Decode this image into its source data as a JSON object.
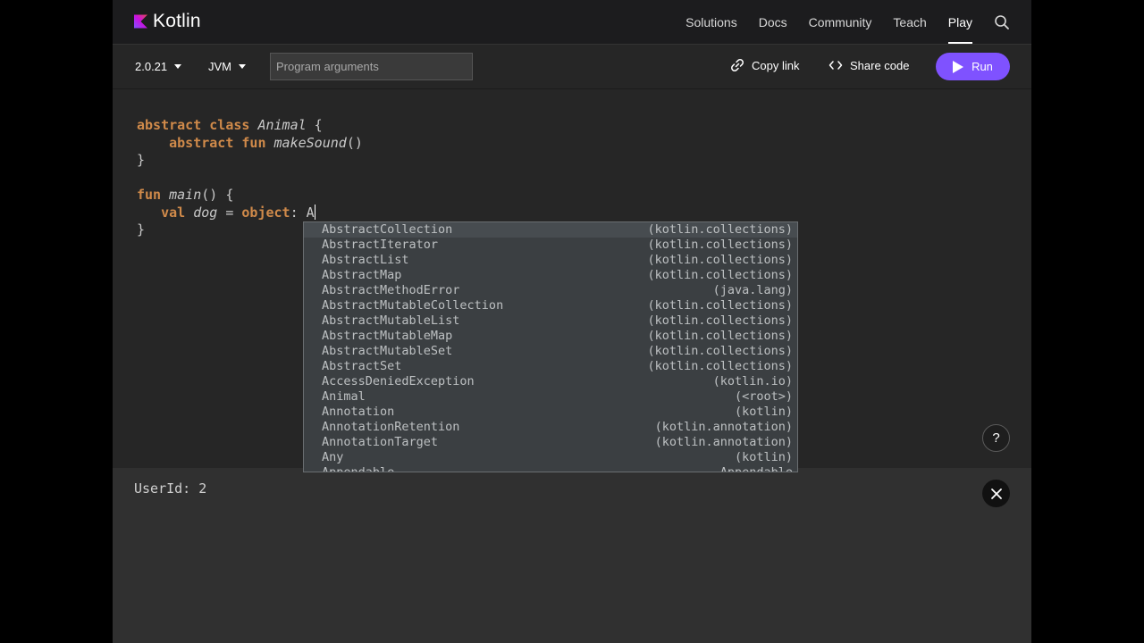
{
  "brand": {
    "name": "Kotlin",
    "logo_colors": [
      "#7f52ff",
      "#c811e1",
      "#e54857"
    ]
  },
  "nav": {
    "links": [
      "Solutions",
      "Docs",
      "Community",
      "Teach",
      "Play"
    ],
    "active": "Play",
    "search_icon": "search-icon"
  },
  "toolbar": {
    "version": "2.0.21",
    "target": "JVM",
    "args_placeholder": "Program arguments",
    "copy_link": "Copy link",
    "share_code": "Share code",
    "run": "Run",
    "run_color": "#7f52ff"
  },
  "editor": {
    "lines": [
      [
        {
          "t": "abstract class ",
          "c": "kw"
        },
        {
          "t": "Animal",
          "c": "it"
        },
        {
          "t": " {",
          "c": ""
        }
      ],
      [
        {
          "t": "    ",
          "c": ""
        },
        {
          "t": "abstract fun ",
          "c": "kw"
        },
        {
          "t": "makeSound",
          "c": "it"
        },
        {
          "t": "()",
          "c": ""
        }
      ],
      [
        {
          "t": "}",
          "c": ""
        }
      ],
      [],
      [
        {
          "t": "fun ",
          "c": "kw"
        },
        {
          "t": "main",
          "c": "it"
        },
        {
          "t": "() {",
          "c": ""
        }
      ],
      [
        {
          "t": "   ",
          "c": ""
        },
        {
          "t": "val ",
          "c": "kw"
        },
        {
          "t": "dog",
          "c": "it"
        },
        {
          "t": " = ",
          "c": ""
        },
        {
          "t": "object",
          "c": "kw"
        },
        {
          "t": ": A",
          "c": ""
        },
        {
          "t": "",
          "c": "cursor"
        }
      ],
      [
        {
          "t": "}",
          "c": ""
        }
      ]
    ]
  },
  "completion": {
    "items": [
      {
        "name": "AbstractCollection",
        "pkg": "(kotlin.collections)"
      },
      {
        "name": "AbstractIterator",
        "pkg": "(kotlin.collections)"
      },
      {
        "name": "AbstractList",
        "pkg": "(kotlin.collections)"
      },
      {
        "name": "AbstractMap",
        "pkg": "(kotlin.collections)"
      },
      {
        "name": "AbstractMethodError",
        "pkg": "(java.lang)"
      },
      {
        "name": "AbstractMutableCollection",
        "pkg": "(kotlin.collections)"
      },
      {
        "name": "AbstractMutableList",
        "pkg": "(kotlin.collections)"
      },
      {
        "name": "AbstractMutableMap",
        "pkg": "(kotlin.collections)"
      },
      {
        "name": "AbstractMutableSet",
        "pkg": "(kotlin.collections)"
      },
      {
        "name": "AbstractSet",
        "pkg": "(kotlin.collections)"
      },
      {
        "name": "AccessDeniedException",
        "pkg": "(kotlin.io)"
      },
      {
        "name": "Animal",
        "pkg": "(<root>)"
      },
      {
        "name": "Annotation",
        "pkg": "(kotlin)"
      },
      {
        "name": "AnnotationRetention",
        "pkg": "(kotlin.annotation)"
      },
      {
        "name": "AnnotationTarget",
        "pkg": "(kotlin.annotation)"
      },
      {
        "name": "Any",
        "pkg": "(kotlin)"
      },
      {
        "name": "Appendable",
        "pkg": "Appendable"
      }
    ]
  },
  "output": {
    "text": "UserId: 2"
  },
  "help": {
    "label": "?"
  }
}
